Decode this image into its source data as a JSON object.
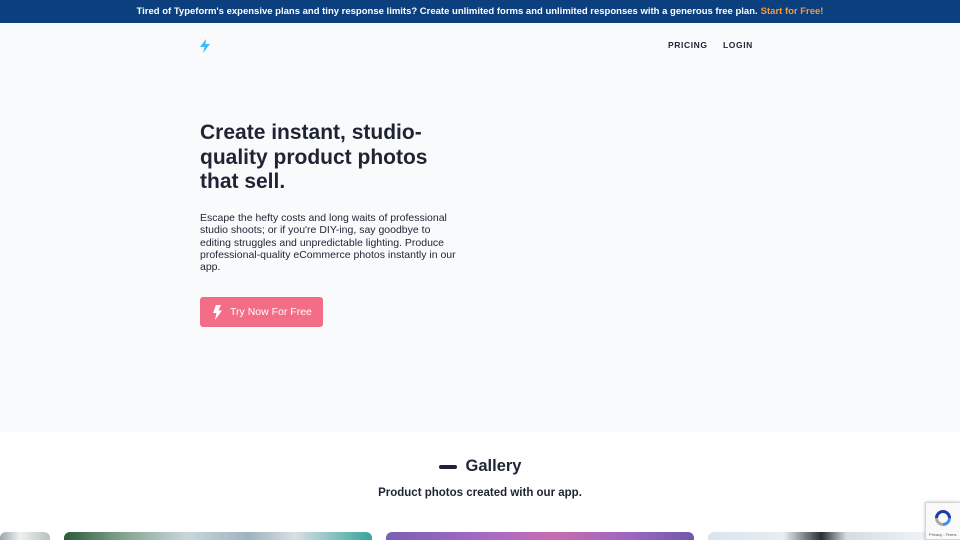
{
  "announcement": {
    "text": "Tired of Typeform's expensive plans and tiny response limits? Create unlimited forms and unlimited responses with a generous free plan.",
    "cta": "Start for Free!"
  },
  "nav": {
    "logo_icon": "lightning-bolt-icon",
    "links": [
      "PRICING",
      "LOGIN"
    ]
  },
  "hero": {
    "title": "Create instant, studio-quality product photos that sell.",
    "description": "Escape the hefty costs and long waits of professional studio shoots; or if you're DIY-ing, say goodbye to editing struggles and unpredictable lighting. Produce professional-quality eCommerce photos instantly in our app.",
    "button_label": "Try Now For Free",
    "button_icon": "lightning-bolt-icon"
  },
  "gallery": {
    "title": "Gallery",
    "subtitle": "Product photos created with our app."
  },
  "recaptcha": {
    "text": "Privacy - Terms"
  },
  "colors": {
    "announcement_bg": "#0b3f7e",
    "announcement_cta": "#f59a3e",
    "cta_button": "#f26d85",
    "logo": "#38bdf8",
    "text": "#1e2433",
    "page_bg": "#f8fafc"
  }
}
